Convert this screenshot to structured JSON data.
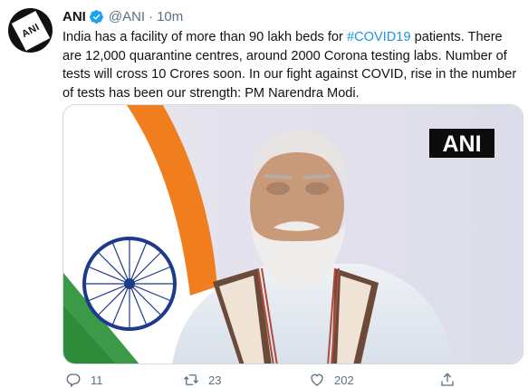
{
  "tweet": {
    "author_name": "ANI",
    "author_handle": "@ANI",
    "separator": "·",
    "time": "10m",
    "text_before": "India has a facility of more than 90 lakh beds for ",
    "hashtag": "#COVID19",
    "text_after": " patients. There are 12,000 quarantine centres, around 2000 Corona testing labs. Number of tests will cross 10 Crores soon. In our fight against COVID, rise in the number of tests has been our strength: PM Narendra Modi.",
    "avatar_logo": "ANI",
    "media_watermark": "ANI"
  },
  "actions": {
    "reply_count": "11",
    "retweet_count": "23",
    "like_count": "202"
  },
  "icons": {
    "verified": "verified-badge-icon",
    "reply": "reply-icon",
    "retweet": "retweet-icon",
    "like": "heart-icon",
    "share": "share-icon"
  },
  "colors": {
    "accent": "#1b95e0",
    "secondary_text": "#5b7083",
    "saffron": "#f07d1e",
    "green": "#2e8b3a",
    "chakra": "#1e3a8a"
  }
}
